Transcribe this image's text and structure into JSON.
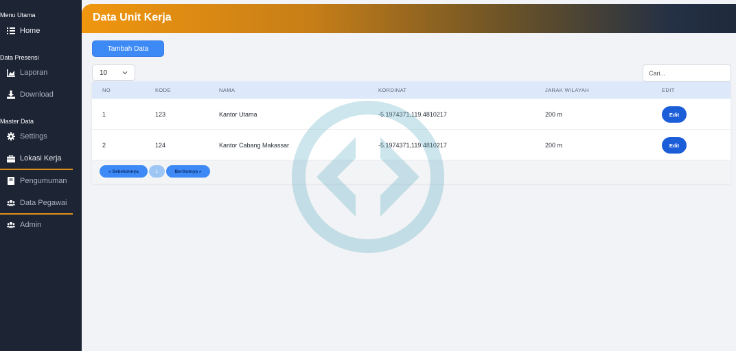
{
  "sidebar": {
    "sections": {
      "menu_utama": "Menu Utama",
      "data_presensi": "Data Presensi",
      "master_data": "Master Data"
    },
    "items": {
      "home": "Home",
      "laporan": "Laporan",
      "download": "Download",
      "settings": "Settings",
      "lokasi_kerja": "Lokasi Kerja",
      "pengumuman": "Pengumuman",
      "data_pegawai": "Data Pegawai",
      "admin": "Admin"
    }
  },
  "header": {
    "title": "Data Unit Kerja"
  },
  "toolbar": {
    "add_label": "Tambah Data",
    "page_size": "10",
    "search_placeholder": "Cari..."
  },
  "table": {
    "columns": [
      "NO",
      "KODE",
      "NAMA",
      "KORDINAT",
      "JARAK WILAYAH",
      "EDIT"
    ],
    "rows": [
      {
        "no": "1",
        "kode": "123",
        "nama": "Kantor Utama",
        "kordinat": "-5.1974371,119.4810217",
        "jarak": "200 m",
        "edit": "Edit"
      },
      {
        "no": "2",
        "kode": "124",
        "nama": "Kantor Cabang Makassar",
        "kordinat": "-5.1974371,119.4810217",
        "jarak": "200 m",
        "edit": "Edit"
      }
    ]
  },
  "pagination": {
    "prev": "« Sebelumnya",
    "current": "1",
    "next": "Berikutnya »"
  },
  "colors": {
    "sidebar_bg": "#1d2434",
    "accent_orange": "#f0960f",
    "primary_blue": "#3d8af7",
    "edit_blue": "#1c5ed8",
    "table_header_bg": "#dde9fb"
  }
}
